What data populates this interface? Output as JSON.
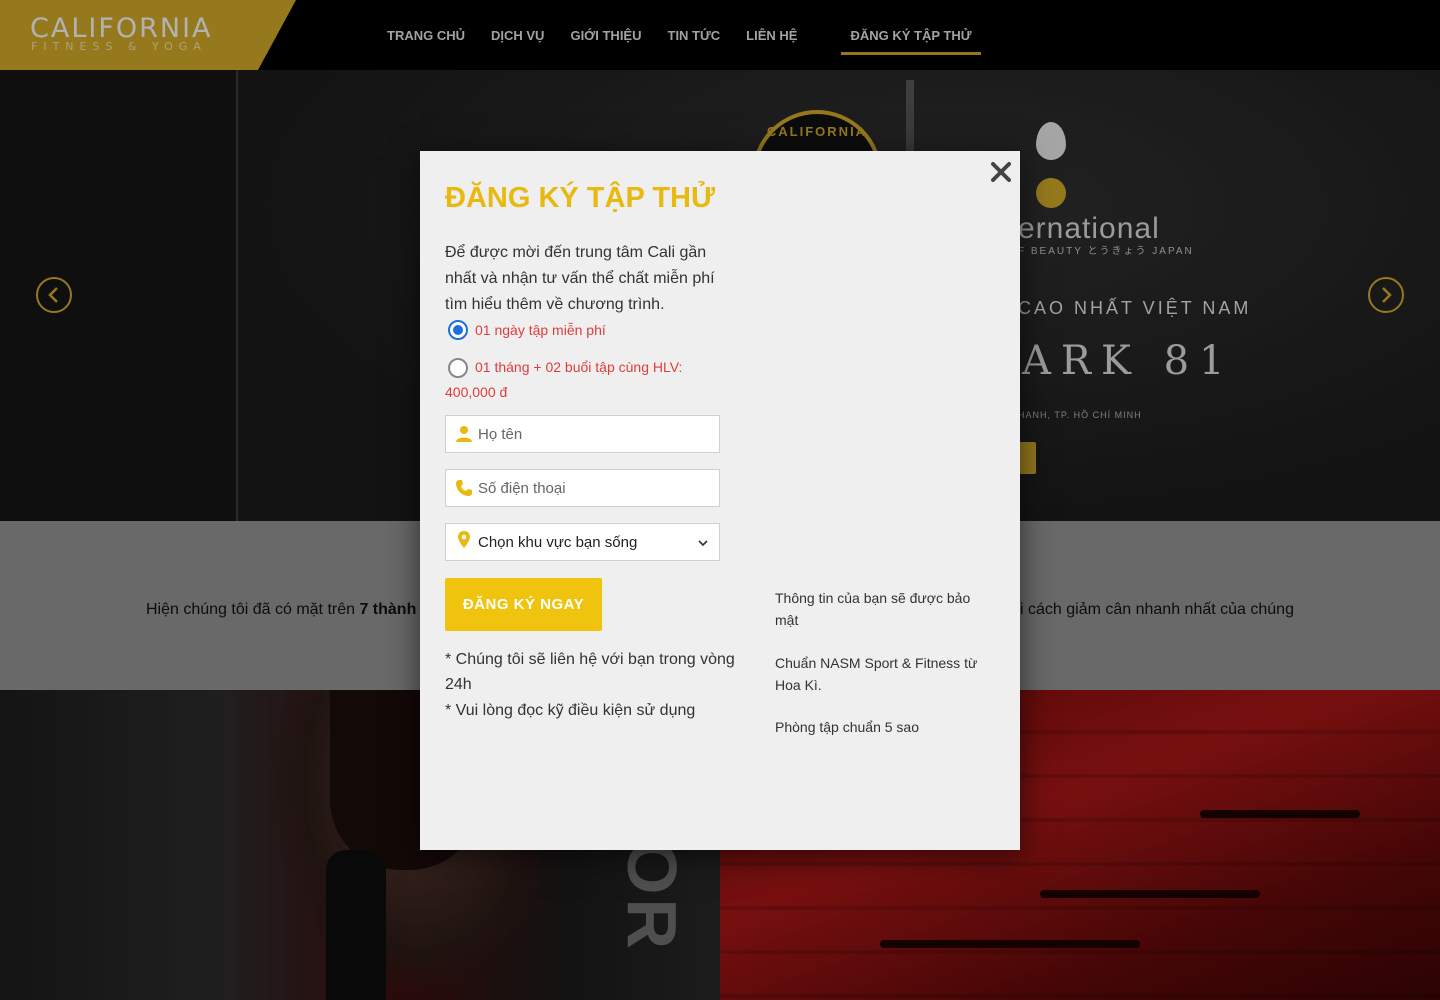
{
  "header": {
    "logo_title": "CALIFORNIA",
    "logo_subtitle": "FITNESS & YOGA",
    "nav": [
      {
        "label": "TRANG CHỦ"
      },
      {
        "label": "DỊCH VỤ"
      },
      {
        "label": "GIỚI THIỆU"
      },
      {
        "label": "TIN TỨC"
      },
      {
        "label": "LIÊN HỆ"
      },
      {
        "label": "ĐĂNG KÝ TẬP THỬ"
      }
    ]
  },
  "hero": {
    "badge_text": "CALIFORNIA",
    "brand_text": "ernational",
    "brand_sub": "F BEAUTY とうきょう JAPAN",
    "tagline": "CAO NHẤT VIỆT NAM",
    "building": "ARK 81",
    "address": "HANH, TP. HỒ CHÍ MINH",
    "prev_icon": "chevron-left-icon",
    "next_icon": "chevron-right-icon"
  },
  "intro": {
    "text_prefix": "Hiện chúng tôi đã có mặt trên ",
    "text_bold": "7 thành",
    "text_right": "i cách giảm cân nhanh nhất của chúng"
  },
  "bottom": {
    "left_letters": "OR"
  },
  "modal": {
    "close_icon": "close-icon",
    "title": "ĐĂNG KÝ TẬP THỬ",
    "description": "Để được mời đến trung tâm Cali gần nhất và nhận tư vấn thể chất miễn phí tìm hiểu thêm về chương trình.",
    "options": [
      {
        "label": "01 ngày tập miễn phí",
        "checked": true
      },
      {
        "label": "01 tháng + 02 buổi tập cùng HLV: 400,000 đ",
        "checked": false
      }
    ],
    "name_placeholder": "Họ tên",
    "phone_placeholder": "Số điện thoại",
    "region_value": "Chọn khu vực bạn sống",
    "submit_label": "ĐĂNG KÝ NGAY",
    "notes": [
      "* Chúng tôi sẽ liên hệ với bạn trong vòng 24h",
      "* Vui lòng đọc kỹ điều kiện sử dụng"
    ],
    "benefits": [
      "Thông tin của bạn sẽ được bảo mật",
      "Chuẩn NASM Sport & Fitness từ Hoa Kì.",
      "Phòng tập chuẩn 5 sao"
    ],
    "icons": {
      "name": "user-icon",
      "phone": "phone-icon",
      "region": "map-pin-icon",
      "dropdown": "chevron-down-icon"
    }
  },
  "colors": {
    "brand_gold": "#c9a227",
    "title_yellow": "#e8b90f",
    "button_yellow": "#f0c40e",
    "option_red": "#e03c3c",
    "radio_blue": "#1d6fe0",
    "header_bg": "#000000",
    "modal_bg": "#efefef"
  }
}
